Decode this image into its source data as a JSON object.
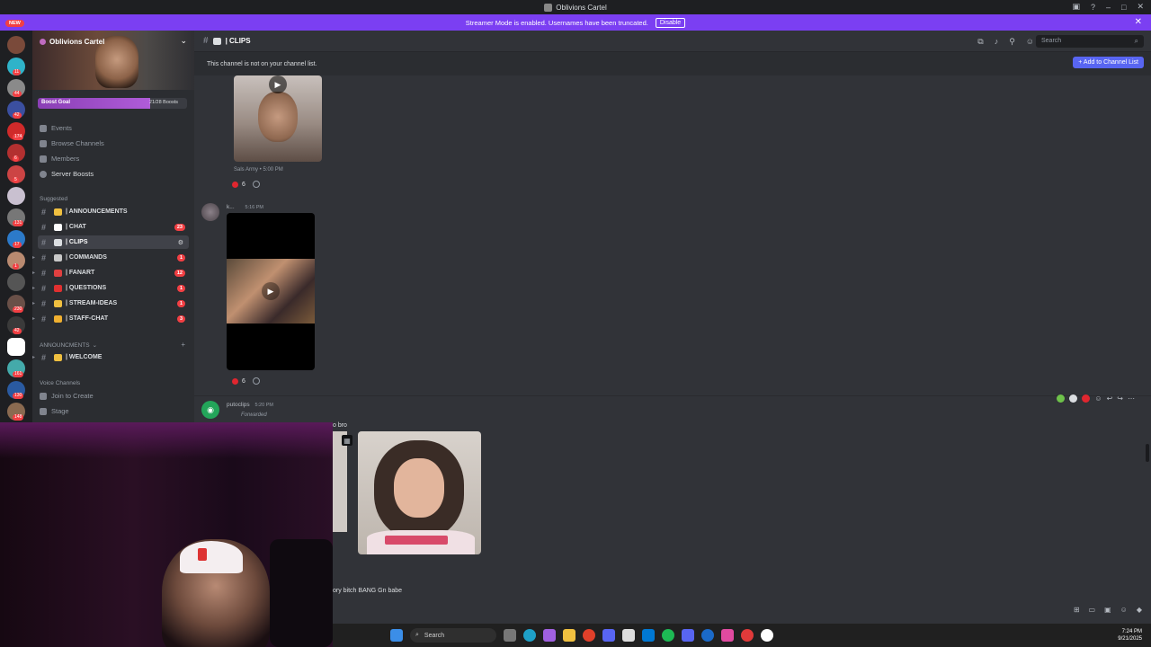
{
  "window": {
    "title": "Oblivions Cartel"
  },
  "banner": {
    "text": "Streamer Mode is enabled. Usernames have been truncated.",
    "button": "Disable",
    "color": "#7b3ff2"
  },
  "guilds": {
    "new_label": "NEW",
    "badges": [
      "11",
      "44",
      "42",
      "174",
      "6",
      "5",
      "131",
      "17",
      "1",
      "230",
      "42",
      "161",
      "130",
      "148"
    ]
  },
  "server": {
    "name": "Oblivions Cartel",
    "boost_goal_label": "Boost Goal",
    "boost_count": "21/28 Boosts",
    "boost_progress": 0.75
  },
  "nav": {
    "events": "Events",
    "browse": "Browse Channels",
    "members": "Members",
    "server_boosts": "Server Boosts"
  },
  "sections": {
    "suggested": "Suggested",
    "announcements": "ANNOUNCMENTS",
    "voice": "Voice Channels"
  },
  "channels": [
    {
      "name": "| ANNOUNCEMENTS",
      "badge": ""
    },
    {
      "name": "| CHAT",
      "badge": "23"
    },
    {
      "name": "| CLIPS",
      "badge": ""
    },
    {
      "name": "| COMMANDS",
      "badge": "1"
    },
    {
      "name": "| FANART",
      "badge": "12"
    },
    {
      "name": "| QUESTIONS",
      "badge": "1"
    },
    {
      "name": "| STREAM-IDEAS",
      "badge": "1"
    },
    {
      "name": "| STAFF-CHAT",
      "badge": "3"
    }
  ],
  "welcome_channel": "| WELCOME",
  "voice_channels": [
    "Join to Create",
    "Stage"
  ],
  "header": {
    "channel": "| CLIPS",
    "search_placeholder": "Search"
  },
  "notice": {
    "text": "This channel is not on your channel list.",
    "button": "+ Add to Channel List"
  },
  "messages": {
    "msg1_meta": "Sals Army • 5:00 PM",
    "msg1_react_count": "6",
    "msg2_user": "k...",
    "msg2_time": "5:16 PM",
    "msg2_react_count": "6",
    "msg3_user": "putoclips",
    "msg3_time": "5:20 PM",
    "msg3_forwarded": "Forwarded",
    "msg3_top_text": "o bro",
    "msg3_bottom_text": "ory bitch BANG Gn babe"
  },
  "taskbar": {
    "search": "Search",
    "time": "7:24 PM",
    "date": "9/21/2025"
  }
}
